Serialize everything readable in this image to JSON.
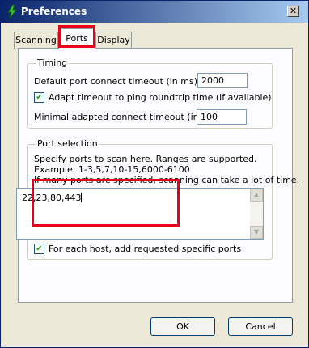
{
  "window": {
    "title": "Preferences",
    "close_glyph": "✕",
    "app_icon": "lightning-icon"
  },
  "tabs": [
    {
      "label": "Scanning",
      "selected": false
    },
    {
      "label": "Ports",
      "selected": true
    },
    {
      "label": "Display",
      "selected": false
    }
  ],
  "timing": {
    "legend": "Timing",
    "default_timeout_label": "Default port connect timeout (in ms):",
    "default_timeout_value": "2000",
    "adapt_checkbox_label": "Adapt timeout to ping roundtrip time (if available)",
    "adapt_checked": true,
    "min_timeout_label": "Minimal adapted connect timeout (in ms):",
    "min_timeout_value": "100"
  },
  "port_selection": {
    "legend": "Port selection",
    "help_line1": "Specify ports to scan here. Ranges are supported.",
    "help_line2": "Example: 1-3,5,7,10-15,6000-6100",
    "help_line3": "If many ports are specified, scanning can take a lot of time.",
    "ports_value": "22,23,80,443",
    "each_host_label": "For each host, add requested specific ports",
    "each_host_checked": true
  },
  "buttons": {
    "ok": "OK",
    "cancel": "Cancel"
  },
  "colors": {
    "highlight": "#e8001a",
    "titlebar": "#0a246a",
    "check": "#21a121"
  }
}
